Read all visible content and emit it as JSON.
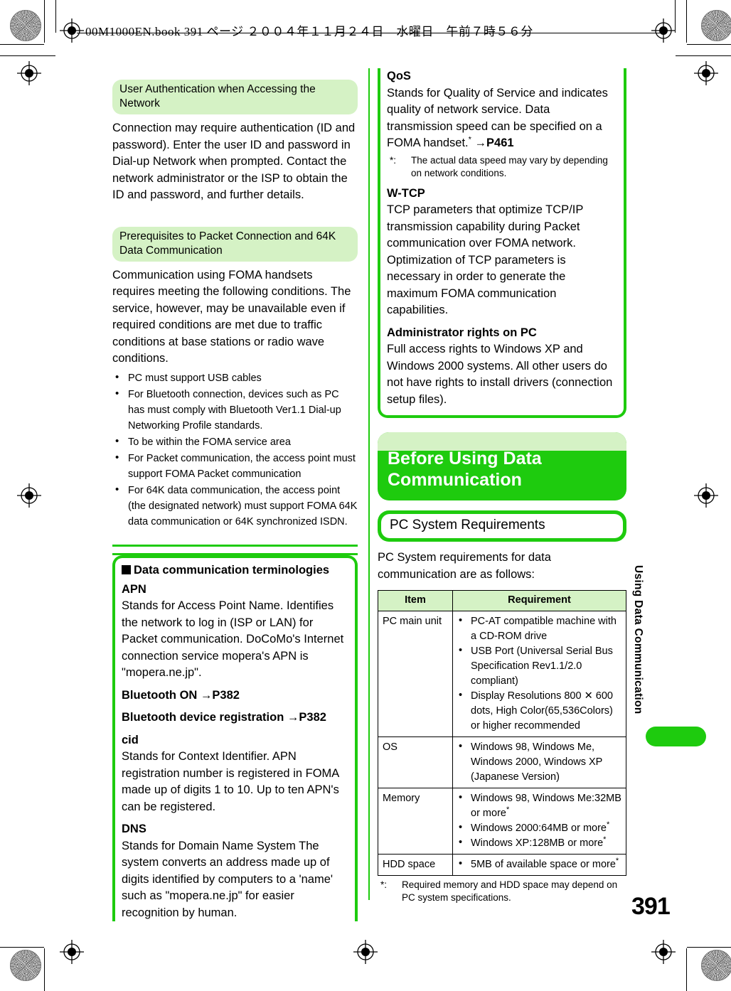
{
  "page": {
    "header_line": "00M1000EN.book  391 ページ  ２００４年１１月２４日　水曜日　午前７時５６分",
    "page_number": "391",
    "side_tab_label": "Using Data Communication",
    "accent_green": "#1ecb0e",
    "pale_green": "#d5f2c5"
  },
  "left_column": {
    "section1": {
      "heading": "User Authentication when Accessing the Network",
      "body": "Connection may require authentication (ID and password). Enter the user ID and password in Dial-up Network when prompted. Contact the network administrator or the ISP to obtain the ID and password, and further details."
    },
    "section2": {
      "heading": "Prerequisites to Packet Connection and 64K Data Communication",
      "body": "Communication using FOMA handsets requires meeting the following conditions. The service, however, may be unavailable even if required conditions are met due to traffic conditions at base stations or radio wave conditions.",
      "bullets": [
        "PC must support USB cables",
        "For Bluetooth connection, devices such as PC has must comply with Bluetooth Ver1.1 Dial-up Networking Profile standards.",
        "To be within the FOMA service area",
        "For Packet communication, the access point must support FOMA Packet communication",
        "For 64K data communication, the access point (the designated network) must support FOMA 64K data communication or 64K synchronized ISDN."
      ]
    },
    "terminology_box": {
      "title": "Data communication terminologies",
      "marker_icon": "filled-square-icon",
      "entries": [
        {
          "term": "APN",
          "definition": "Stands for Access Point Name. Identifies the network to log in (ISP or LAN) for Packet communication. DoCoMo's Internet connection service mopera's APN is \"mopera.ne.jp\"."
        },
        {
          "term": "Bluetooth ON",
          "reference": "→P382",
          "definition": ""
        },
        {
          "term": "Bluetooth device registration",
          "reference": "→P382",
          "definition": ""
        },
        {
          "term": "cid",
          "definition": "Stands for Context Identifier. APN registration number is registered in FOMA made up of digits 1 to 10. Up to ten APN's can be registered."
        },
        {
          "term": "DNS",
          "definition": "Stands for Domain Name System The system converts an address made up of digits identified by computers to a 'name' such as \"mopera.ne.jp\" for easier recognition by human."
        }
      ]
    }
  },
  "right_column": {
    "terminology_continued": [
      {
        "term": "QoS",
        "definition": "Stands for Quality of Service and indicates quality of network service. Data transmission speed can be specified on a FOMA handset.",
        "reference": "→P461",
        "footnote_mark": "*:",
        "footnote": "The actual data speed may vary by depending on network conditions."
      },
      {
        "term": "W-TCP",
        "definition": "TCP parameters that optimize TCP/IP transmission capability during Packet communication over FOMA network. Optimization of TCP parameters is necessary in order to generate the maximum FOMA communication capabilities."
      },
      {
        "term": "Administrator rights on PC",
        "definition": "Full access rights to Windows XP and Windows 2000 systems. All other users do not have rights to install drivers (connection setup files)."
      }
    ],
    "chapter_heading": "Before Using Data Communication",
    "section_heading": "PC System Requirements",
    "section_intro": "PC System requirements for data communication are as follows:",
    "table": {
      "columns": [
        "Item",
        "Requirement"
      ],
      "rows": [
        {
          "item": "PC main unit",
          "requirements": [
            "PC-AT compatible machine with a CD-ROM drive",
            "USB Port (Universal Serial Bus Specification Rev1.1/2.0 compliant)",
            "Display Resolutions 800 ✕ 600 dots, High Color(65,536Colors) or higher recommended"
          ]
        },
        {
          "item": "OS",
          "requirements": [
            "Windows 98, Windows Me, Windows 2000, Windows XP (Japanese Version)"
          ]
        },
        {
          "item": "Memory",
          "requirements": [
            "Windows 98, Windows Me:32MB or more*",
            "Windows 2000:64MB or more*",
            "Windows XP:128MB or more*"
          ]
        },
        {
          "item": "HDD space",
          "requirements": [
            "5MB of available space or more*"
          ]
        }
      ],
      "footnote_mark": "*:",
      "footnote": "Required memory and HDD space may depend on PC system specifications."
    }
  }
}
